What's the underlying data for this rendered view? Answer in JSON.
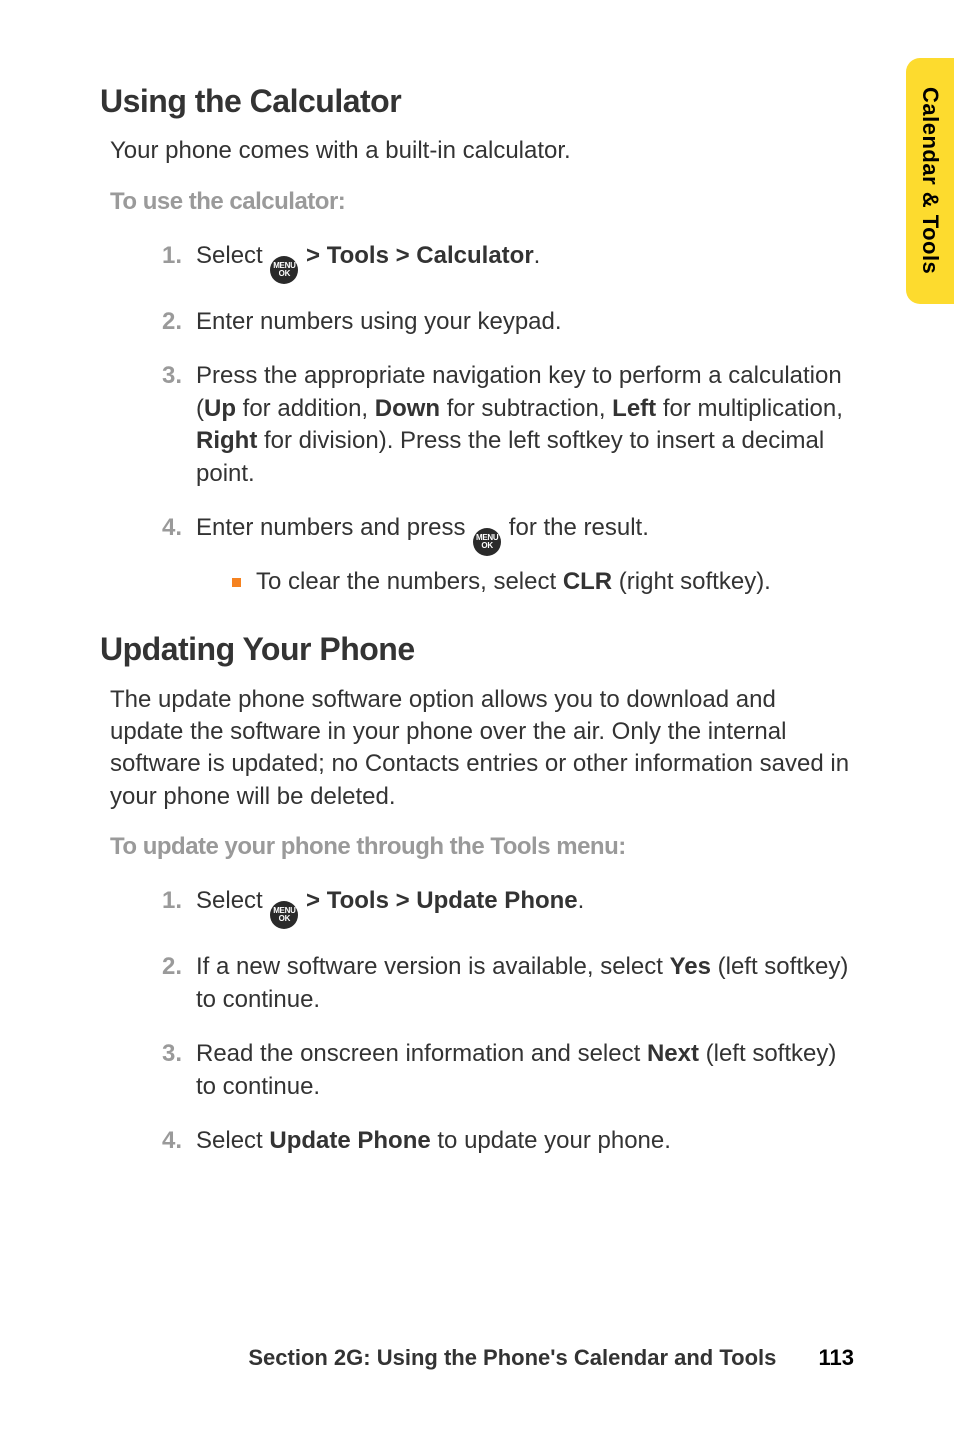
{
  "side_tab": {
    "label": "Calendar & Tools"
  },
  "menu_icon": {
    "top": "MENU",
    "bottom": "OK"
  },
  "section1": {
    "heading": "Using the Calculator",
    "intro": "Your phone comes with a built-in calculator.",
    "subhead": "To use the calculator:",
    "steps": [
      {
        "num": "1.",
        "pre": "Select ",
        "post_icon": " ",
        "bold1": "> Tools > Calculator",
        "tail": "."
      },
      {
        "num": "2.",
        "plain": "Enter numbers using your keypad."
      },
      {
        "num": "3.",
        "s3_a": "Press the appropriate navigation key to perform a calculation (",
        "b_up": "Up",
        "s3_b": " for addition, ",
        "b_down": "Down",
        "s3_c": " for subtraction, ",
        "b_left": "Left",
        "s3_d": " for multiplication, ",
        "b_right": "Right",
        "s3_e": " for division). Press the left softkey to insert a decimal point."
      },
      {
        "num": "4.",
        "s4_a": "Enter numbers and press ",
        "s4_b": " for the result.",
        "sub": {
          "a": "To clear the numbers, select ",
          "b_clr": "CLR",
          "b": " (right softkey)."
        }
      }
    ]
  },
  "section2": {
    "heading": "Updating Your Phone",
    "intro": "The update phone software option allows you to download and update the software in your phone over the air. Only the internal software is updated; no Contacts entries or other information saved in your phone will be deleted.",
    "subhead": "To update your phone through the Tools menu:",
    "steps": [
      {
        "num": "1.",
        "pre": "Select ",
        "post_icon": " ",
        "bold1": "> Tools > Update Phone",
        "tail": "."
      },
      {
        "num": "2.",
        "a": "If a new software version is available, select ",
        "b_yes": "Yes",
        "b": " (left softkey) to continue."
      },
      {
        "num": "3.",
        "a": "Read the onscreen information and select ",
        "b_next": "Next",
        "b": " (left softkey) to continue."
      },
      {
        "num": "4.",
        "a": "Select ",
        "b_up": "Update Phone",
        "b": " to update your phone."
      }
    ]
  },
  "footer": {
    "text": "Section 2G: Using the Phone's Calendar and Tools",
    "page": "113"
  }
}
